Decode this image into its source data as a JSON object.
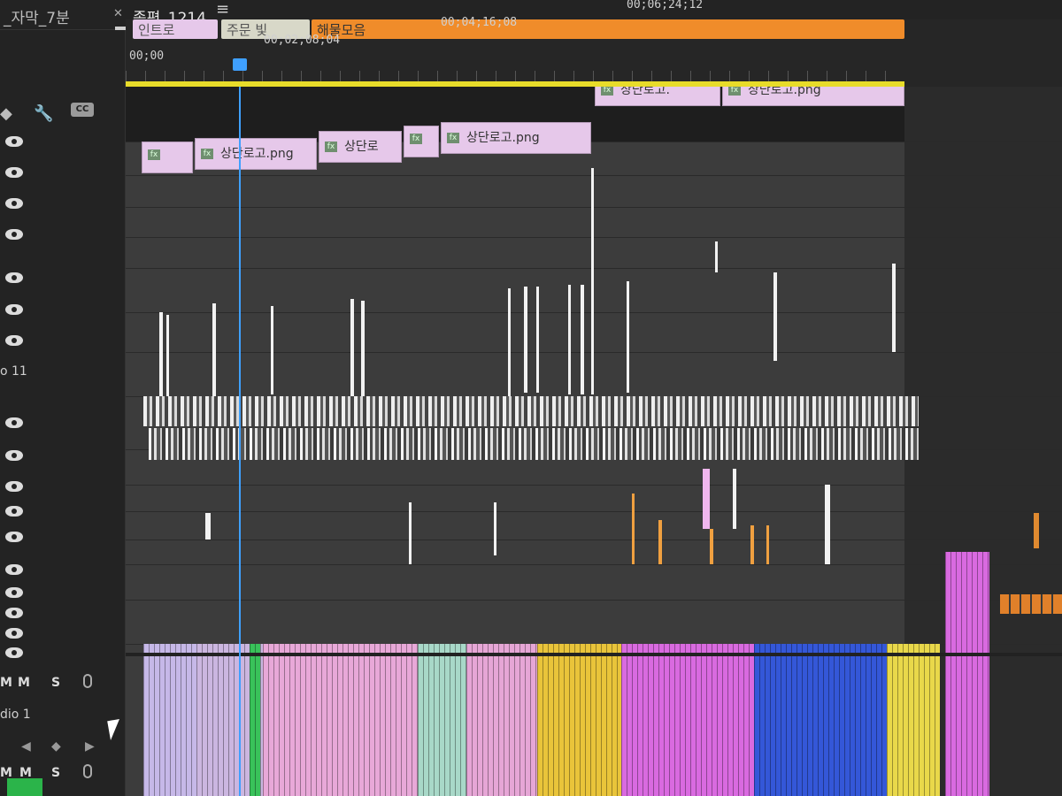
{
  "tabs": [
    {
      "label": "_자막_7분",
      "active": false
    },
    {
      "label": "종편_1214",
      "active": true
    }
  ],
  "ruler": {
    "timecodes": [
      "00;00",
      "00;02;08;04",
      "00;04;16;08",
      "00;06;24;12"
    ],
    "markers": [
      {
        "label": "인트로",
        "color": "#e6c8ea"
      },
      {
        "label": "주문 빛",
        "color": "#d8d8c8"
      },
      {
        "label": "해물모음",
        "color": "#f08c2a"
      }
    ]
  },
  "header": {
    "tools": [
      "marker-icon",
      "wrench-icon"
    ],
    "cc_label": "CC",
    "track_labels": {
      "video11": "o 11",
      "audio1": "dio 1"
    },
    "audio_controls": {
      "mute": "M",
      "solo": "S"
    }
  },
  "clips": {
    "row1": [
      {
        "label": "상단로고."
      },
      {
        "label": "상단로고.png"
      }
    ],
    "row2": [
      {
        "label": "상단로고.png"
      },
      {
        "label": "상단로"
      },
      {
        "label": "상단로고.png"
      }
    ]
  },
  "colors": {
    "playhead": "#3fa0ff",
    "workarea": "#e8dc2a",
    "clip_pink": "#e6c8ea",
    "audio_magenta": "#d96ae0",
    "audio_yellow": "#e9c43a",
    "audio_blue": "#3457d8",
    "audio_green": "#39c25a"
  }
}
